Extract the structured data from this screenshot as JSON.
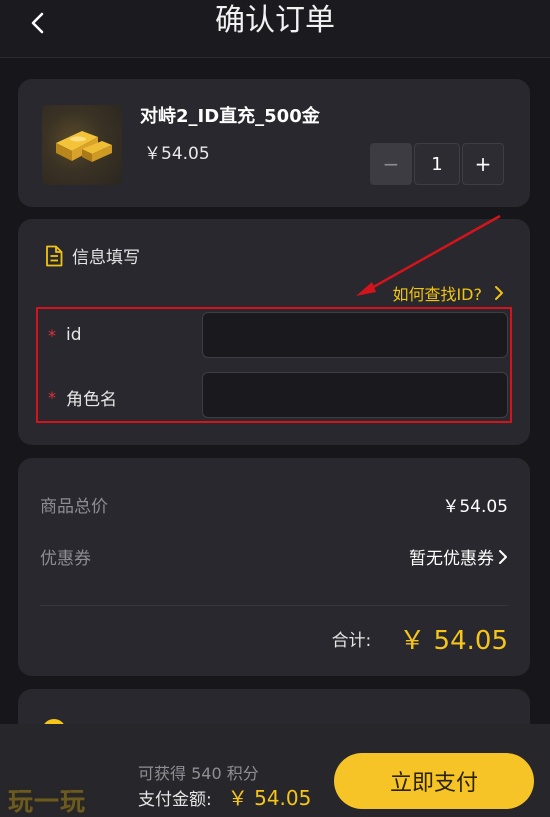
{
  "header": {
    "title": "确认订单"
  },
  "product": {
    "name": "对峙2_ID直充_500金",
    "price": "￥54.05",
    "quantity": "1",
    "minus": "−",
    "plus": "+"
  },
  "info": {
    "title": "信息填写",
    "find_id": "如何查找ID?",
    "fields": [
      {
        "required": "*",
        "label": "id",
        "value": ""
      },
      {
        "required": "*",
        "label": "角色名",
        "value": ""
      }
    ]
  },
  "summary": {
    "total_price_label": "商品总价",
    "total_price_value": "￥54.05",
    "coupon_label": "优惠券",
    "coupon_value": "暂无优惠券",
    "subtotal_label": "合计:",
    "subtotal_value": "￥ 54.05"
  },
  "footer": {
    "logo": "玩一玩",
    "points": "可获得 540 积分",
    "pay_label": "支付金额:",
    "pay_amount": "￥ 54.05",
    "pay_button": "立即支付"
  },
  "colors": {
    "accent": "#f5c518",
    "highlight_box": "#d4141c",
    "background": "#17171b",
    "card": "#28282e"
  }
}
